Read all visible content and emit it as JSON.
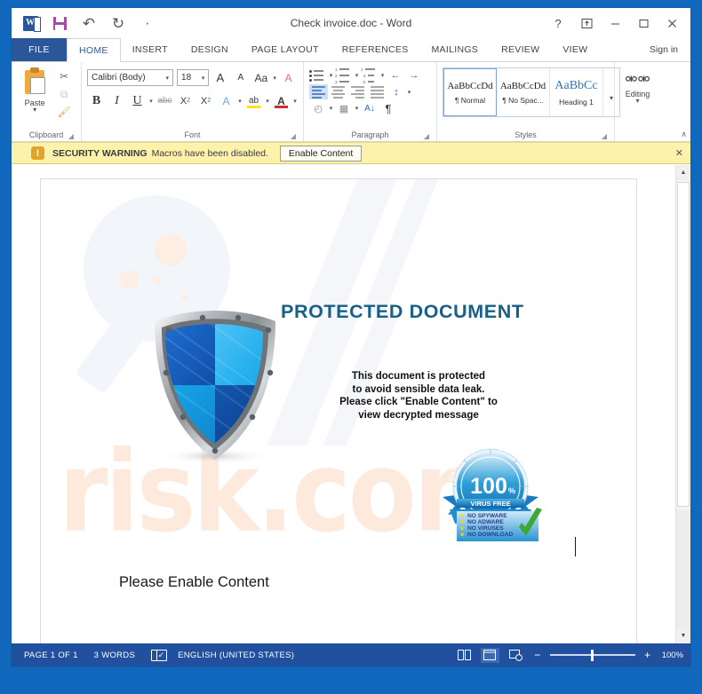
{
  "window": {
    "title": "Check invoice.doc - Word",
    "quick_access": [
      {
        "name": "word-app-icon",
        "label": "W"
      },
      {
        "name": "save-icon",
        "label": ""
      },
      {
        "name": "undo-icon",
        "label": "↶"
      },
      {
        "name": "redo-icon",
        "label": "↻"
      },
      {
        "name": "customize-qat-icon",
        "label": "·"
      }
    ],
    "controls": {
      "help": "?",
      "ribbon_display_options": "ribbon-options-icon",
      "minimize": "—",
      "maximize": "☐",
      "close": "✕"
    },
    "sign_in": "Sign in"
  },
  "ribbon": {
    "file_tab": "FILE",
    "tabs": [
      {
        "label": "HOME",
        "active": true
      },
      {
        "label": "INSERT",
        "active": false
      },
      {
        "label": "DESIGN",
        "active": false
      },
      {
        "label": "PAGE LAYOUT",
        "active": false
      },
      {
        "label": "REFERENCES",
        "active": false
      },
      {
        "label": "MAILINGS",
        "active": false
      },
      {
        "label": "REVIEW",
        "active": false
      },
      {
        "label": "VIEW",
        "active": false
      }
    ],
    "groups": {
      "clipboard": {
        "label": "Clipboard",
        "paste_label": "Paste",
        "cut": "✂",
        "copy": "⧉",
        "format_painter": "🖌"
      },
      "font": {
        "label": "Font",
        "font_name": "Calibri (Body)",
        "font_size": "18",
        "grow_font": "A",
        "shrink_font": "A",
        "change_case": "Aa",
        "clear_formatting": "A",
        "bold": "B",
        "italic": "I",
        "underline": "U",
        "strikethrough": "abc",
        "subscript": "X",
        "superscript": "X",
        "text_effects": "A",
        "highlight": "ab",
        "font_color": "A"
      },
      "paragraph": {
        "label": "Paragraph",
        "bullets": "bullets-icon",
        "numbering": "numbering-icon",
        "multilevel": "multilevel-list-icon",
        "decrease_indent": "←",
        "increase_indent": "→",
        "align_left": "align-left-icon",
        "center": "align-center-icon",
        "align_right": "align-right-icon",
        "justify": "justify-icon",
        "line_spacing": "↕",
        "shading": "shading-icon",
        "borders": "borders-icon",
        "sort": "A\nZ↓",
        "show_marks": "¶"
      },
      "styles": {
        "label": "Styles",
        "items": [
          {
            "preview": "AaBbCcDd",
            "name": "¶ Normal",
            "selected": true,
            "kind": "normal"
          },
          {
            "preview": "AaBbCcDd",
            "name": "¶ No Spac...",
            "selected": false,
            "kind": "normal"
          },
          {
            "preview": "AaBbCc",
            "name": "Heading 1",
            "selected": false,
            "kind": "heading"
          }
        ],
        "more": "▾"
      },
      "editing": {
        "label": "Editing",
        "button_label": "Editing",
        "icon": "binoculars-icon",
        "caret": "▾"
      }
    },
    "collapse": "∧"
  },
  "security_bar": {
    "title": "SECURITY WARNING",
    "message": "Macros have been disabled.",
    "button": "Enable Content",
    "close": "✕",
    "icon": "!"
  },
  "document": {
    "heading": "PROTECTED DOCUMENT",
    "body_lines": [
      "This document is protected",
      "to avoid sensible data leak.",
      "Please click \"Enable Content\" to",
      "view decrypted message"
    ],
    "footer_text": "Please Enable Content",
    "watermark_text": "risk.com",
    "shield": {
      "name": "protection-shield-graphic"
    },
    "seal": {
      "name": "virus-free-seal-graphic",
      "arc_text": "SATISFACTION GUARANTEED",
      "percent": "100",
      "percent_suffix": "%",
      "ribbon_text": "VIRUS FREE",
      "list": [
        "NO SPYWARE",
        "NO ADWARE",
        "NO VIRUSES",
        "NO DOWNLOAD"
      ],
      "check": "✔"
    }
  },
  "statusbar": {
    "page": "PAGE 1 OF 1",
    "words": "3 WORDS",
    "proofing_icon": "proofing-errors-icon",
    "language": "ENGLISH (UNITED STATES)",
    "views": [
      {
        "name": "read-mode-view-button",
        "selected": false
      },
      {
        "name": "print-layout-view-button",
        "selected": true
      },
      {
        "name": "web-layout-view-button",
        "selected": false
      }
    ],
    "zoom_out": "−",
    "zoom_in": "+",
    "zoom_level": "100%"
  },
  "colors": {
    "word_blue": "#2b579a",
    "desktop_blue": "#1268bc",
    "warning_yellow": "#fdf2ab",
    "heading_teal": "#176087",
    "status_blue": "#21509f"
  }
}
